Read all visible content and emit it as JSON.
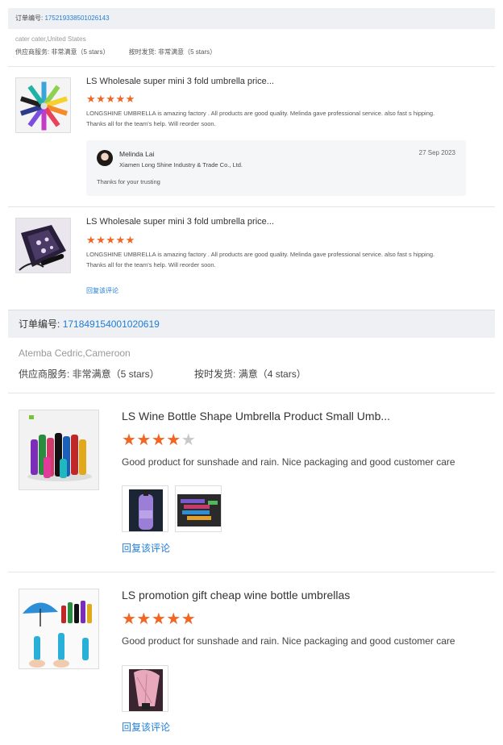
{
  "order1": {
    "label": "订单编号:",
    "number": "175219338501026143",
    "location": "cater cater,United States",
    "rating_service": "供应商服务: 非常满意（5 stars）",
    "rating_delivery": "按时发货: 非常满意（5 stars）",
    "reviews": [
      {
        "title": "LS Wholesale super mini 3 fold umbrella price...",
        "stars": "★★★★★",
        "text": "LONGSHINE UMBRELLA is amazing factory . All products are good quality. Melinda gave professional service. also fast s hipping. Thanks all for the team's help.  Will reorder soon.",
        "reply": {
          "name": "Melinda Lai",
          "company": "Xiamen Long Shine Industry & Trade Co., Ltd.",
          "date": "27 Sep 2023",
          "text": "Thanks for your trusting"
        }
      },
      {
        "title": "LS Wholesale super mini 3 fold umbrella price...",
        "stars": "★★★★★",
        "text": "LONGSHINE UMBRELLA is amazing factory . All products are good quality. Melinda gave professional service. also fast s hipping. Thanks all for the team's help.  Will reorder soon.",
        "reply_link": "回复该评论"
      }
    ]
  },
  "order2": {
    "label": "订单编号:",
    "number": "171849154001020619",
    "location": "Atemba Cedric,Cameroon",
    "rating_service": "供应商服务: 非常满意（5 stars）",
    "rating_delivery": "按时发货: 满意（4 stars）",
    "reviews": [
      {
        "title": "LS Wine Bottle Shape Umbrella Product Small Umb...",
        "stars_on": "★★★★",
        "stars_off": "★",
        "text": "Good product for sunshade and rain. Nice packaging and good customer care",
        "reply_link": "回复该评论"
      },
      {
        "title": "LS promotion gift cheap wine bottle umbrellas",
        "stars_on": "★★★★★",
        "stars_off": "",
        "text": "Good product for sunshade and rain. Nice packaging and good customer care",
        "reply_link": "回复该评论"
      }
    ]
  },
  "colors": {
    "link": "#1f7dd6",
    "star": "#f26522",
    "star_off": "#c8c8c8",
    "order_bar": "#eef0f3"
  }
}
